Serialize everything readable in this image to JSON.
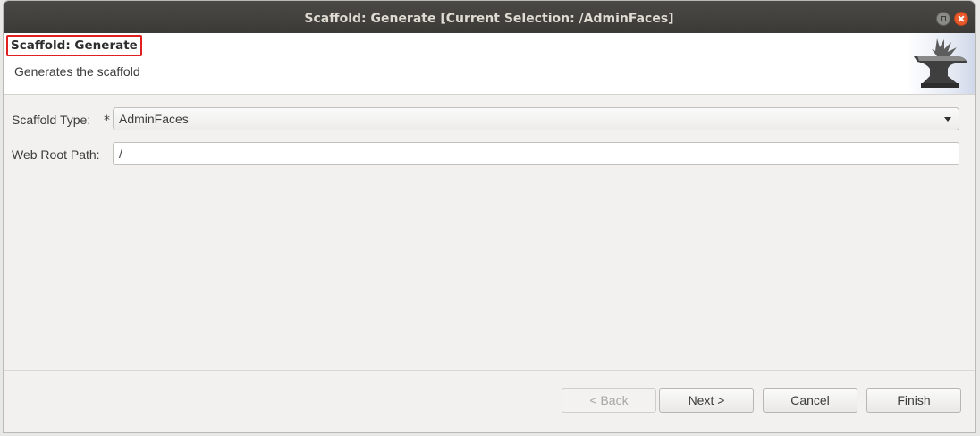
{
  "window": {
    "title": "Scaffold: Generate [Current Selection: /AdminFaces]"
  },
  "header": {
    "title": "Scaffold: Generate",
    "description": "Generates the scaffold",
    "logo_icon": "anvil-icon"
  },
  "form": {
    "scaffold_type_label": "Scaffold Type:",
    "required_marker": "*",
    "scaffold_type_value": "AdminFaces",
    "web_root_label": "Web Root Path:",
    "web_root_value": "/"
  },
  "buttons": {
    "back": "< Back",
    "next": "Next >",
    "cancel": "Cancel",
    "finish": "Finish"
  },
  "colors": {
    "titlebar": "#3e3d39",
    "highlight_border": "#e02020",
    "close_button": "#e85a2b"
  }
}
